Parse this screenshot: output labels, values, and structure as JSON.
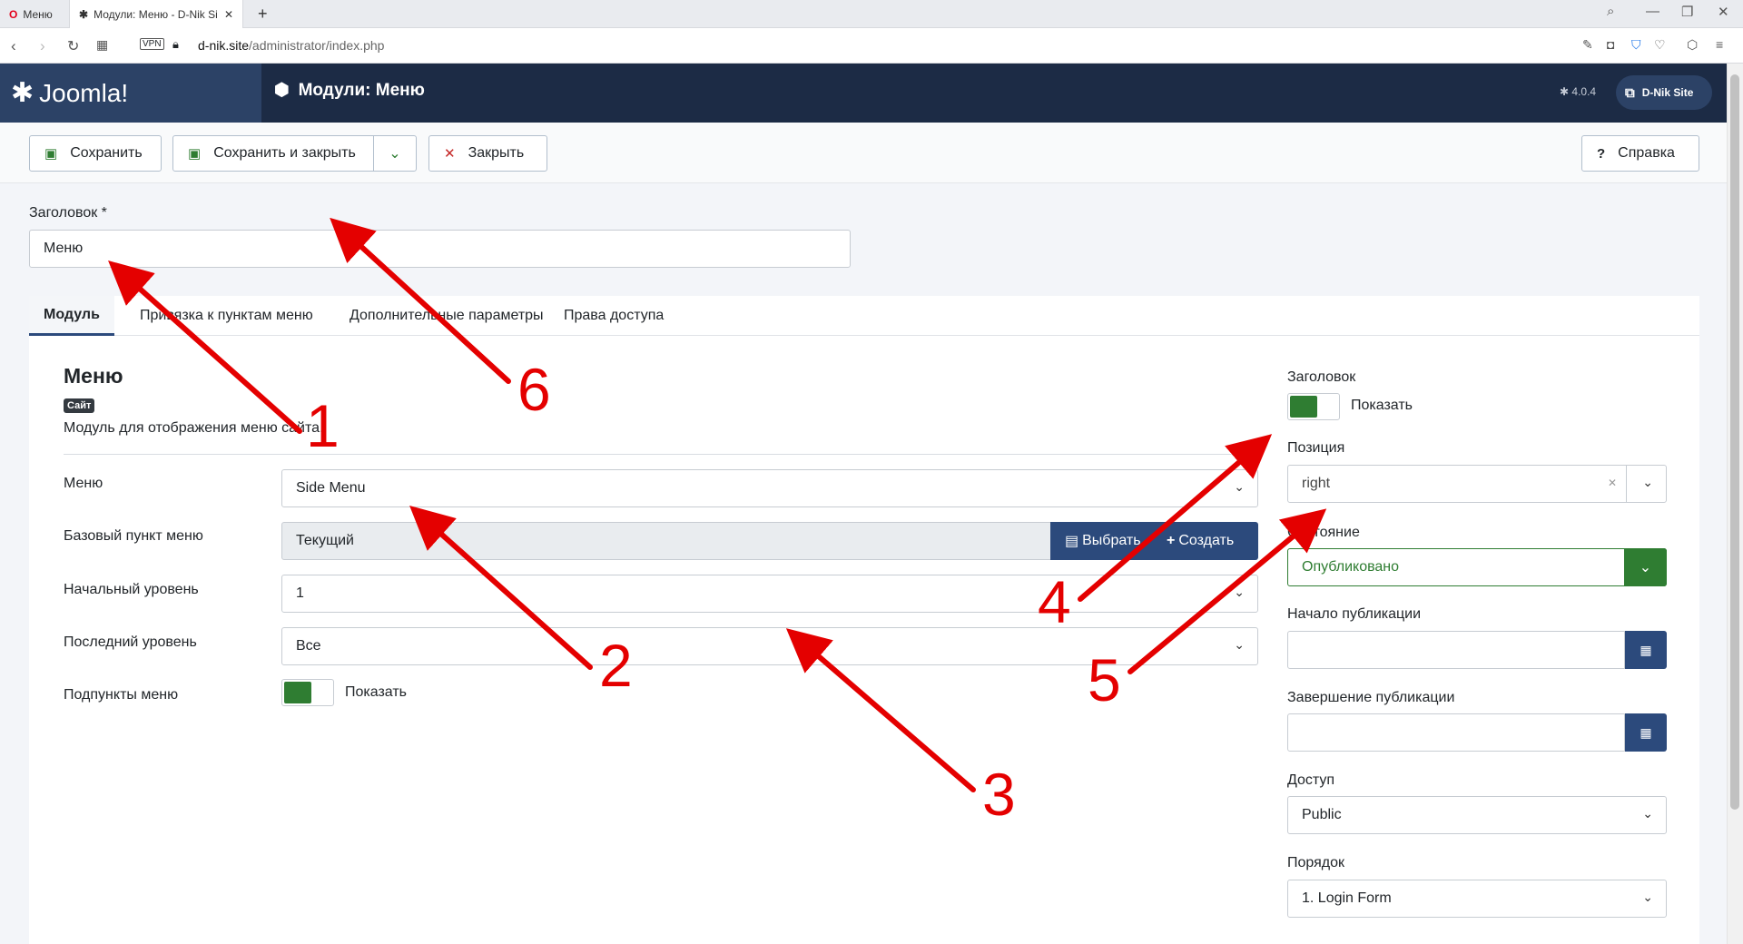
{
  "browser": {
    "tabs": [
      {
        "title": "Меню"
      },
      {
        "title": "Модули: Меню - D-Nik Si"
      }
    ],
    "new_tab": "+",
    "vpn_badge": "VPN",
    "url_domain": "d-nik.site",
    "url_path": "/administrator/index.php"
  },
  "header": {
    "logo_text": "Joomla!",
    "title": "Модули: Меню",
    "version": "4.0.4",
    "site_button": "D-Nik Site",
    "colors": {
      "dark": "#1c2b45",
      "logo_bg": "#2c4266"
    }
  },
  "toolbar": {
    "save": "Сохранить",
    "save_close": "Сохранить и закрыть",
    "close": "Закрыть",
    "help": "Справка"
  },
  "form": {
    "title_label": "Заголовок *",
    "title_value": "Меню",
    "tabs": [
      "Модуль",
      "Привязка к пунктам меню",
      "Дополнительные параметры",
      "Права доступа"
    ],
    "module_heading": "Меню",
    "site_badge": "Сайт",
    "module_desc": "Модуль для отображения меню сайта.",
    "fields": {
      "menu_label": "Меню",
      "menu_value": "Side Menu",
      "base_label": "Базовый пункт меню",
      "base_value": "Текущий",
      "select_btn": "Выбрать",
      "create_btn": "Создать",
      "start_label": "Начальный уровень",
      "start_value": "1",
      "end_label": "Последний уровень",
      "end_value": "Все",
      "sub_label": "Подпункты меню",
      "sub_toggle": "Показать"
    },
    "sidebar": {
      "title_label": "Заголовок",
      "title_toggle": "Показать",
      "position_label": "Позиция",
      "position_value": "right",
      "status_label": "Состояние",
      "status_value": "Опубликовано",
      "pub_start_label": "Начало публикации",
      "pub_end_label": "Завершение публикации",
      "access_label": "Доступ",
      "access_value": "Public",
      "order_label": "Порядок",
      "order_value": "1. Login Form"
    }
  },
  "annotations": [
    "1",
    "2",
    "3",
    "4",
    "5",
    "6"
  ],
  "colors": {
    "accent": "#2c4a7c",
    "toggle_on": "#2f7d32",
    "annotation": "#e40000"
  }
}
